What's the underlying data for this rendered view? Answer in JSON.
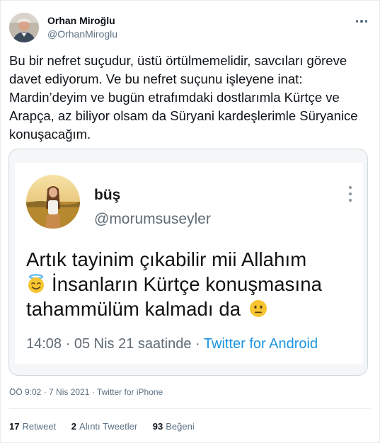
{
  "author": {
    "display_name": "Orhan Miroğlu",
    "handle": "@OrhanMiroglu",
    "avatar_icon": "user-avatar-photo"
  },
  "tweet": {
    "text": "Bu bir nefret suçudur, üstü örtülmemelidir, savcıları göreve davet ediyorum. Ve bu nefret suçunu işleyene inat: Mardin’deyim ve bugün etrafımdaki dostlarımla Kürtçe ve Arapça, az biliyor olsam da Süryani kardeşlerimle Süryanice konuşacağım."
  },
  "embedded_screenshot": {
    "name": "büş",
    "handle": "@morumsuseyler",
    "text_line1": "Artık tayinim çıkabilir mii Allahım",
    "text_line2": "İnsanların Kürtçe konuşmasına",
    "text_line3": "tahammülüm kalmadı da",
    "emoji_1": "smiling-face-with-halo",
    "emoji_2": "neutral-face",
    "timestamp": "14:08 · 05 Nis 21 saatinde · ",
    "source": "Twitter for Android"
  },
  "meta": {
    "text": "ÖÖ 9:02 · 7 Nis 2021 · Twitter for iPhone"
  },
  "stats": {
    "retweets_count": "17",
    "retweets_label": "Retweet",
    "quotes_count": "2",
    "quotes_label": "Alıntı Tweetler",
    "likes_count": "93",
    "likes_label": "Beğeni"
  },
  "colors": {
    "text": "#0f1419",
    "secondary": "#5b7083",
    "link": "#1b95e0",
    "border": "#e6ecf0"
  }
}
